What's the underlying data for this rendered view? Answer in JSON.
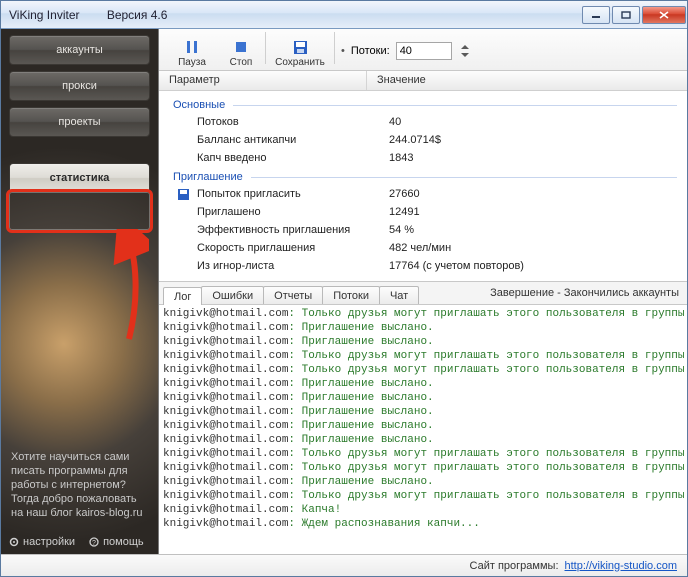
{
  "window": {
    "title": "ViKing Inviter",
    "version": "Версия 4.6"
  },
  "sidebar": {
    "items": [
      {
        "label": "аккаунты"
      },
      {
        "label": "прокси"
      },
      {
        "label": "проекты"
      },
      {
        "label": "статистика"
      }
    ],
    "promo": "Хотите научиться сами писать программы для работы с интернетом? Тогда добро пожаловать на наш блог kairos-blog.ru",
    "settings": "настройки",
    "help": "помощь"
  },
  "toolbar": {
    "pause": "Пауза",
    "stop": "Стоп",
    "save": "Сохранить",
    "threads_label": "Потоки:",
    "threads_value": "40"
  },
  "headers": {
    "param": "Параметр",
    "value": "Значение"
  },
  "groups": {
    "main": {
      "title": "Основные",
      "rows": [
        {
          "k": "Потоков",
          "v": "40"
        },
        {
          "k": "Балланс антикапчи",
          "v": "244.0714$"
        },
        {
          "k": "Капч введено",
          "v": "1843"
        }
      ]
    },
    "invite": {
      "title": "Приглашение",
      "rows": [
        {
          "k": "Попыток пригласить",
          "v": "27660",
          "icon": "save-icon"
        },
        {
          "k": "Приглашено",
          "v": "12491"
        },
        {
          "k": "Эффективность приглашения",
          "v": "54 %"
        },
        {
          "k": "Скорость приглашения",
          "v": "482 чел/мин"
        },
        {
          "k": "Из игнор-листа",
          "v": "17764 (с учетом повторов)"
        }
      ]
    }
  },
  "tabs": {
    "items": [
      "Лог",
      "Ошибки",
      "Отчеты",
      "Потоки",
      "Чат"
    ],
    "status": "Завершение - Закончились аккаунты"
  },
  "log": {
    "email": "knigivk@hotmail.com",
    "msg_friends": "Только друзья могут приглашать этого пользователя в группы.",
    "msg_sent": "Приглашение выслано.",
    "msg_captcha": "Капча!",
    "msg_wait": "Ждем распознавания капчи...",
    "sequence": [
      "friends",
      "sent",
      "sent",
      "friends",
      "friends",
      "sent",
      "sent",
      "sent",
      "sent",
      "sent",
      "friends",
      "friends",
      "sent",
      "friends",
      "captcha",
      "wait"
    ]
  },
  "statusbar": {
    "label": "Сайт программы:",
    "url": "http://viking-studio.com"
  }
}
